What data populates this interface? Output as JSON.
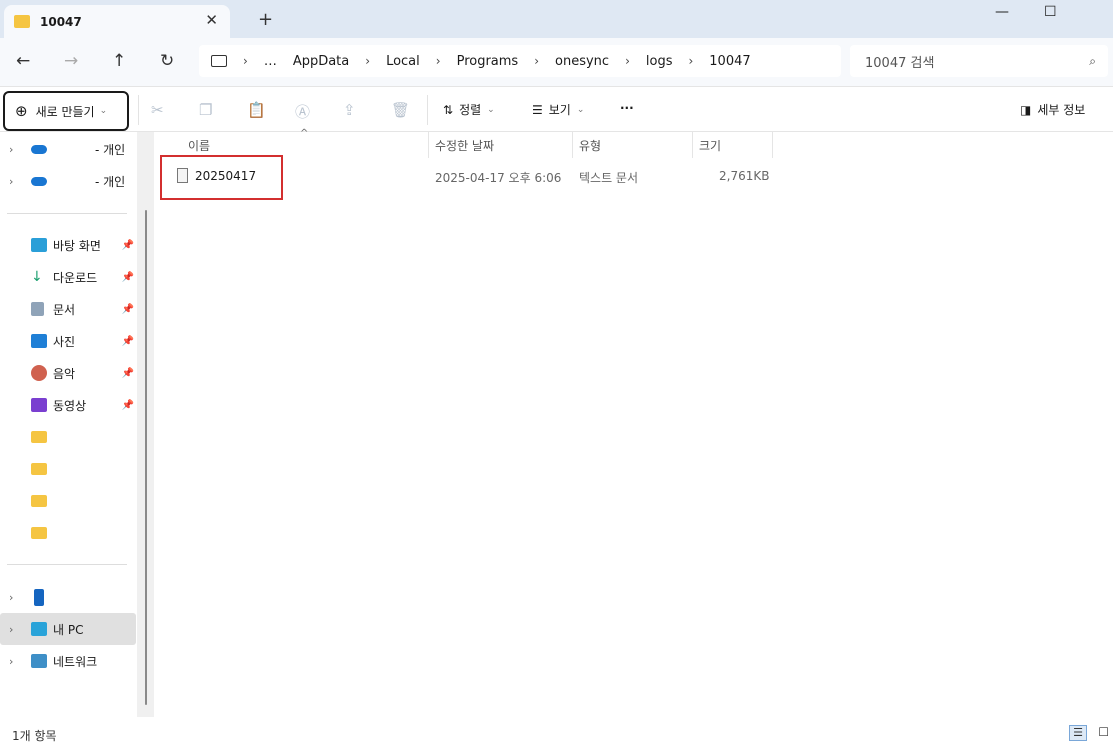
{
  "tab": {
    "title": "10047",
    "close": "✕",
    "new": "+"
  },
  "window": {
    "minimize": "—",
    "maximize": "☐",
    "close": "✕"
  },
  "nav": {
    "back": "←",
    "forward": "→",
    "up": "↑",
    "refresh": "↻"
  },
  "address": {
    "crumbs": [
      "…",
      "AppData",
      "Local",
      "Programs",
      "onesync",
      "logs",
      "10047"
    ]
  },
  "search": {
    "placeholder": "10047 검색"
  },
  "toolbar": {
    "new": "새로 만들기",
    "sort": "정렬",
    "view": "보기",
    "more": "···",
    "details": "세부 정보"
  },
  "sidebar": {
    "cloud": [
      {
        "label": "- 개인"
      },
      {
        "label": "- 개인"
      }
    ],
    "quick": [
      {
        "label": "바탕 화면",
        "icon": "desktop-icon"
      },
      {
        "label": "다운로드",
        "icon": "download-icon"
      },
      {
        "label": "문서",
        "icon": "documents-icon"
      },
      {
        "label": "사진",
        "icon": "pictures-icon"
      },
      {
        "label": "음악",
        "icon": "music-icon"
      },
      {
        "label": "동영상",
        "icon": "videos-icon"
      }
    ],
    "pc": "내 PC",
    "network": "네트워크"
  },
  "columns": {
    "name": "이름",
    "date": "수정한 날짜",
    "type": "유형",
    "size": "크기"
  },
  "files": [
    {
      "name": "20250417",
      "date": "2025-04-17 오후 6:06",
      "type": "텍스트 문서",
      "size": "2,761KB"
    }
  ],
  "status": {
    "count": "1개 항목"
  }
}
